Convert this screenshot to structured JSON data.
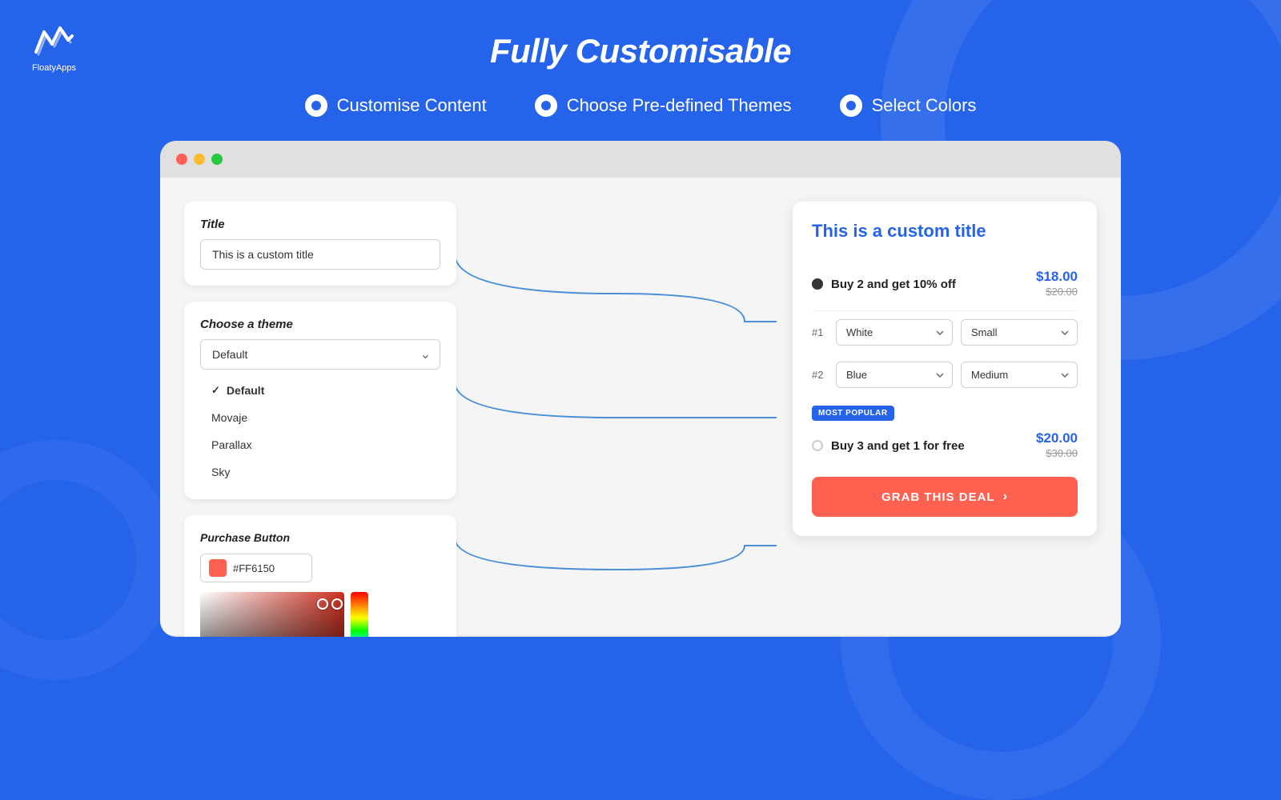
{
  "header": {
    "title": "Fully Customisable",
    "logo_text": "FloatyApps"
  },
  "feature_tabs": [
    {
      "label": "Customise Content",
      "active": true
    },
    {
      "label": "Choose Pre-defined Themes",
      "active": false
    },
    {
      "label": "Select Colors",
      "active": false
    }
  ],
  "left_panel": {
    "title_field": {
      "label": "Title",
      "value": "This is a custom title",
      "placeholder": "This is a custom title"
    },
    "theme_field": {
      "label": "Choose a theme",
      "selected": "Default",
      "options": [
        "Default",
        "Movaje",
        "Parallax",
        "Sky"
      ]
    },
    "color_field": {
      "label": "Purchase Button",
      "hex": "#FF6150"
    }
  },
  "preview": {
    "title": "This is a custom title",
    "deal_1": {
      "text": "Buy 2 and get 10% off",
      "price_current": "$18.00",
      "price_original": "$20.00"
    },
    "variant_1": {
      "num": "#1",
      "color": "White",
      "size": "Small"
    },
    "variant_2": {
      "num": "#2",
      "color": "Blue",
      "size": "Medium"
    },
    "badge": "MOST POPULAR",
    "deal_2": {
      "text": "Buy 3 and get 1 for free",
      "price_current": "$20.00",
      "price_original": "$30.00"
    },
    "cta_button": "GRAB THIS DEAL"
  }
}
